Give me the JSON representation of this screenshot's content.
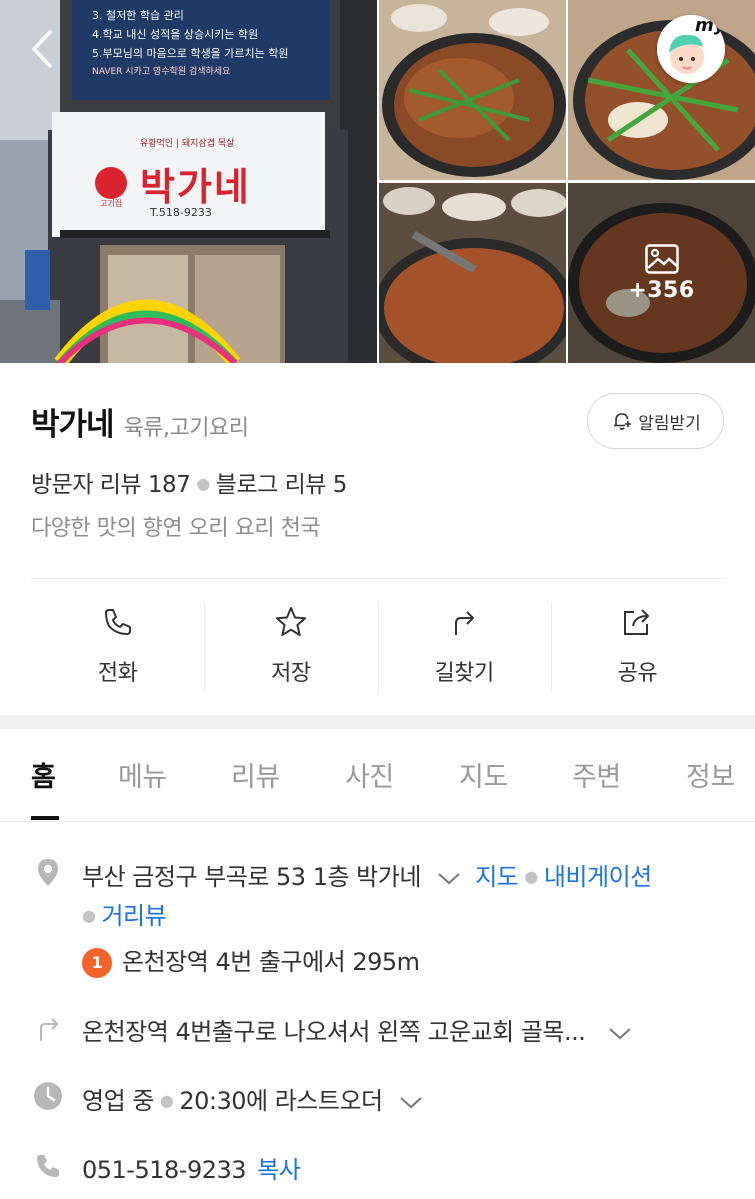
{
  "photos": {
    "sign_name": "박가네",
    "sign_phone": "T.518-9233",
    "sign_tag": "고기집",
    "sign_top": "유황먹인 | 돼지삼겹 목살",
    "banner_lines": [
      "3. 철저한 학습 관리",
      "4.학교 내신 성적을 상승시키는 학원",
      "5.부모님의 마음으로 학생을 가르치는 학원"
    ],
    "banner_footer": "NAVER 시카고 영수학원 검색하세요",
    "my_label": "my",
    "more_count": "+356"
  },
  "place": {
    "name": "박가네",
    "category": "육류,고기요리",
    "alarm_label": "알림받기",
    "visitor_reviews": "방문자 리뷰 187",
    "blog_reviews": "블로그 리뷰 5",
    "description": "다양한 맛의 향연 오리 요리 천국"
  },
  "actions": [
    {
      "label": "전화",
      "icon": "phone-icon"
    },
    {
      "label": "저장",
      "icon": "star-icon"
    },
    {
      "label": "길찾기",
      "icon": "directions-icon"
    },
    {
      "label": "공유",
      "icon": "share-icon"
    }
  ],
  "tabs": [
    {
      "label": "홈",
      "active": true
    },
    {
      "label": "메뉴"
    },
    {
      "label": "리뷰"
    },
    {
      "label": "사진"
    },
    {
      "label": "지도"
    },
    {
      "label": "주변"
    },
    {
      "label": "정보"
    }
  ],
  "details": {
    "address": "부산 금정구 부곡로 53 1층 박가네",
    "map_link": "지도",
    "navigation_link": "내비게이션",
    "street_view_link": "거리뷰",
    "subway_line": "1",
    "subway_text": "온천장역 4번 출구에서 295m",
    "directions_text": "온천장역 4번출구로 나오셔서 왼쪽 고운교회 골목...",
    "status": "영업 중",
    "last_order": "20:30에 라스트오더",
    "phone": "051-518-9233",
    "copy_link": "복사"
  },
  "colors": {
    "link": "#1a73e8",
    "subway_badge": "#f5622a",
    "sign_red": "#d9232e"
  }
}
